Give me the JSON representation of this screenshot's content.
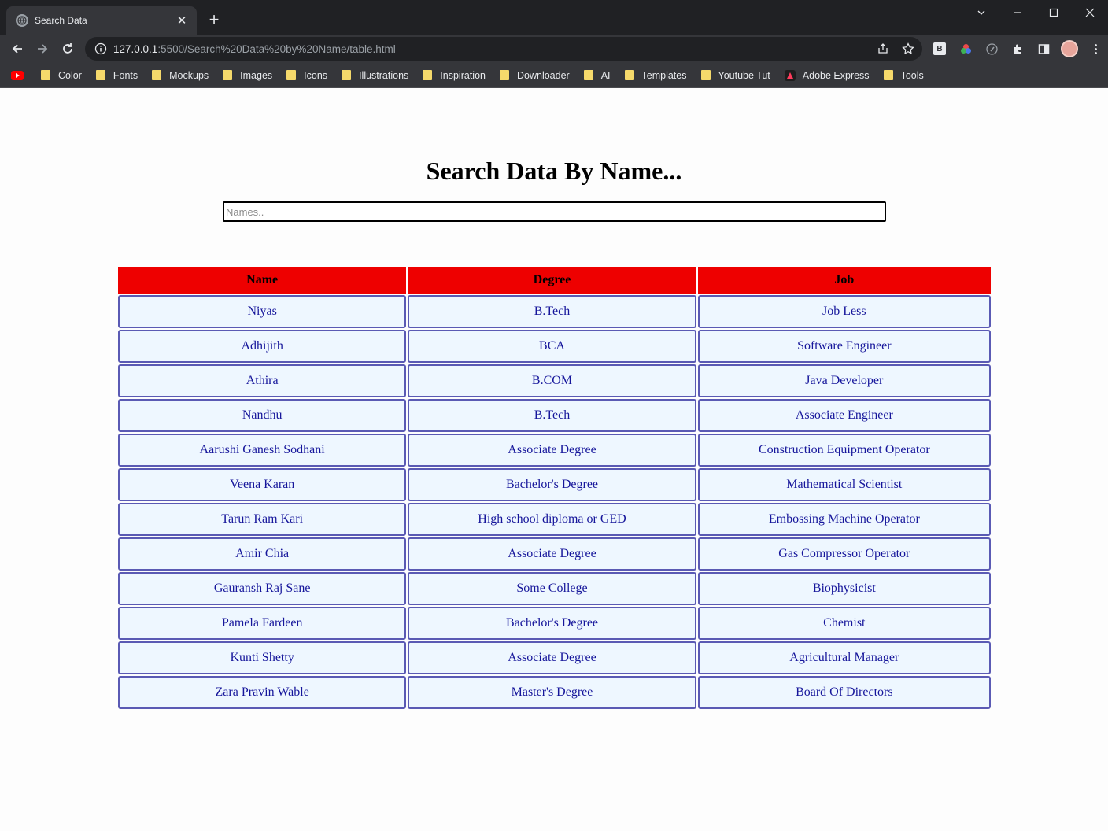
{
  "browser": {
    "tab_title": "Search Data",
    "url_host": "127.0.0.1",
    "url_rest": ":5500/Search%20Data%20by%20Name/table.html",
    "extension_b_label": "B",
    "bookmarks": [
      {
        "label": "",
        "icon": "youtube-icon"
      },
      {
        "label": "Color",
        "icon": "folder-icon"
      },
      {
        "label": "Fonts",
        "icon": "folder-icon"
      },
      {
        "label": "Mockups",
        "icon": "folder-icon"
      },
      {
        "label": "Images",
        "icon": "folder-icon"
      },
      {
        "label": "Icons",
        "icon": "folder-icon"
      },
      {
        "label": "Illustrations",
        "icon": "folder-icon"
      },
      {
        "label": "Inspiration",
        "icon": "folder-icon"
      },
      {
        "label": "Downloader",
        "icon": "folder-icon"
      },
      {
        "label": "AI",
        "icon": "folder-icon"
      },
      {
        "label": "Templates",
        "icon": "folder-icon"
      },
      {
        "label": "Youtube Tut",
        "icon": "folder-icon"
      },
      {
        "label": "Adobe Express",
        "icon": "adobe-express-icon"
      },
      {
        "label": "Tools",
        "icon": "folder-icon"
      }
    ]
  },
  "page": {
    "title": "Search Data By Name...",
    "search": {
      "placeholder": "Names..",
      "value": ""
    },
    "table": {
      "headers": [
        "Name",
        "Degree",
        "Job"
      ],
      "rows": [
        [
          "Niyas",
          "B.Tech",
          "Job Less"
        ],
        [
          "Adhijith",
          "BCA",
          "Software Engineer"
        ],
        [
          "Athira",
          "B.COM",
          "Java Developer"
        ],
        [
          "Nandhu",
          "B.Tech",
          "Associate Engineer"
        ],
        [
          "Aarushi Ganesh Sodhani",
          "Associate Degree",
          "Construction Equipment Operator"
        ],
        [
          "Veena Karan",
          "Bachelor's Degree",
          "Mathematical Scientist"
        ],
        [
          "Tarun Ram Kari",
          "High school diploma or GED",
          "Embossing Machine Operator"
        ],
        [
          "Amir Chia",
          "Associate Degree",
          "Gas Compressor Operator"
        ],
        [
          "Gauransh Raj Sane",
          "Some College",
          "Biophysicist"
        ],
        [
          "Pamela Fardeen",
          "Bachelor's Degree",
          "Chemist"
        ],
        [
          "Kunti Shetty",
          "Associate Degree",
          "Agricultural Manager"
        ],
        [
          "Zara Pravin Wable",
          "Master's Degree",
          "Board Of Directors"
        ]
      ]
    }
  },
  "colors": {
    "header_bg": "#ee0000",
    "cell_bg": "#eef7ff",
    "cell_border": "#5a5ab4",
    "cell_text": "#16169b"
  }
}
